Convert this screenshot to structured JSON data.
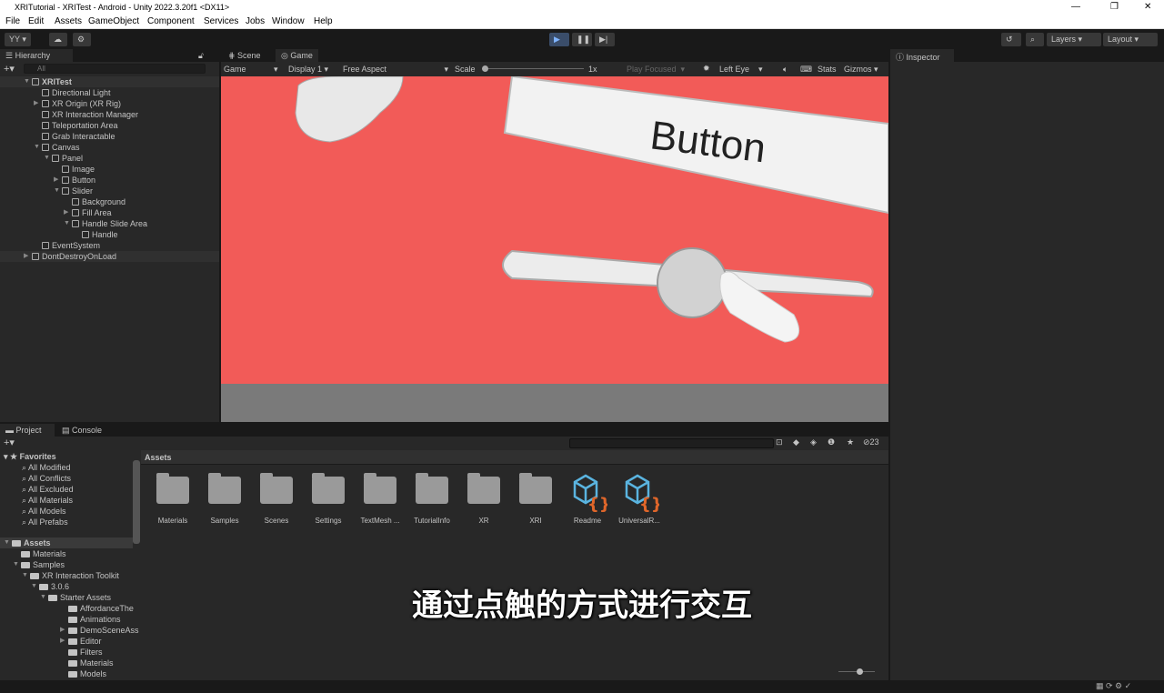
{
  "window": {
    "title": "XRITutorial - XRITest - Android - Unity 2022.3.20f1 <DX11>",
    "minimize": "—",
    "maximize": "❐",
    "close": "✕"
  },
  "menu": [
    "File",
    "Edit",
    "Assets",
    "GameObject",
    "Component",
    "Services",
    "Jobs",
    "Window",
    "Help"
  ],
  "toolbar": {
    "account": "YY ▾",
    "layers": "Layers",
    "layout": "Layout"
  },
  "hierarchy": {
    "tab": "Hierarchy",
    "search_placeholder": "All",
    "items": [
      {
        "label": "XRITest",
        "depth": 0,
        "arrow": "▼",
        "bold": true
      },
      {
        "label": "Directional Light",
        "depth": 1,
        "arrow": ""
      },
      {
        "label": "XR Origin (XR Rig)",
        "depth": 1,
        "arrow": "▶"
      },
      {
        "label": "XR Interaction Manager",
        "depth": 1,
        "arrow": ""
      },
      {
        "label": "Teleportation Area",
        "depth": 1,
        "arrow": ""
      },
      {
        "label": "Grab Interactable",
        "depth": 1,
        "arrow": ""
      },
      {
        "label": "Canvas",
        "depth": 1,
        "arrow": "▼"
      },
      {
        "label": "Panel",
        "depth": 2,
        "arrow": "▼"
      },
      {
        "label": "Image",
        "depth": 3,
        "arrow": ""
      },
      {
        "label": "Button",
        "depth": 3,
        "arrow": "▶"
      },
      {
        "label": "Slider",
        "depth": 3,
        "arrow": "▼"
      },
      {
        "label": "Background",
        "depth": 4,
        "arrow": ""
      },
      {
        "label": "Fill Area",
        "depth": 4,
        "arrow": "▶"
      },
      {
        "label": "Handle Slide Area",
        "depth": 4,
        "arrow": "▼"
      },
      {
        "label": "Handle",
        "depth": 5,
        "arrow": ""
      },
      {
        "label": "EventSystem",
        "depth": 1,
        "arrow": ""
      },
      {
        "label": "DontDestroyOnLoad",
        "depth": 0,
        "arrow": "▶",
        "bold": false
      }
    ]
  },
  "game": {
    "tabs": [
      "Scene",
      "Game"
    ],
    "display_mode": "Game",
    "display": "Display 1",
    "aspect": "Free Aspect",
    "scale_label": "Scale",
    "scale_value": "1x",
    "play_focused": "Play Focused",
    "eye": "Left Eye",
    "stats": "Stats",
    "gizmos": "Gizmos",
    "scene_button_text": "Button",
    "bg_color": "#f25b58"
  },
  "inspector": {
    "tab": "Inspector"
  },
  "project": {
    "tabs": [
      "Project",
      "Console"
    ],
    "hidden_count": "23",
    "breadcrumb": "Assets",
    "favorites_label": "Favorites",
    "favorites": [
      "All Modified",
      "All Conflicts",
      "All Excluded",
      "All Materials",
      "All Models",
      "All Prefabs"
    ],
    "tree": [
      {
        "label": "Assets",
        "depth": 0,
        "arrow": "▼"
      },
      {
        "label": "Materials",
        "depth": 1,
        "arrow": ""
      },
      {
        "label": "Samples",
        "depth": 1,
        "arrow": "▼"
      },
      {
        "label": "XR Interaction Toolkit",
        "depth": 2,
        "arrow": "▼"
      },
      {
        "label": "3.0.6",
        "depth": 3,
        "arrow": "▼"
      },
      {
        "label": "Starter Assets",
        "depth": 4,
        "arrow": "▼"
      },
      {
        "label": "AffordanceThe",
        "depth": 5,
        "arrow": ""
      },
      {
        "label": "Animations",
        "depth": 5,
        "arrow": ""
      },
      {
        "label": "DemoSceneAss",
        "depth": 5,
        "arrow": "▶"
      },
      {
        "label": "Editor",
        "depth": 5,
        "arrow": "▶"
      },
      {
        "label": "Filters",
        "depth": 5,
        "arrow": ""
      },
      {
        "label": "Materials",
        "depth": 5,
        "arrow": ""
      },
      {
        "label": "Models",
        "depth": 5,
        "arrow": ""
      }
    ],
    "assets": [
      {
        "label": "Materials",
        "type": "folder"
      },
      {
        "label": "Samples",
        "type": "folder"
      },
      {
        "label": "Scenes",
        "type": "folder"
      },
      {
        "label": "Settings",
        "type": "folder"
      },
      {
        "label": "TextMesh ...",
        "type": "folder"
      },
      {
        "label": "TutorialInfo",
        "type": "folder"
      },
      {
        "label": "XR",
        "type": "folder"
      },
      {
        "label": "XRI",
        "type": "folder"
      },
      {
        "label": "Readme",
        "type": "script-asset"
      },
      {
        "label": "UniversalR...",
        "type": "script-asset"
      }
    ]
  },
  "subtitle": "通过点触的方式进行交互"
}
